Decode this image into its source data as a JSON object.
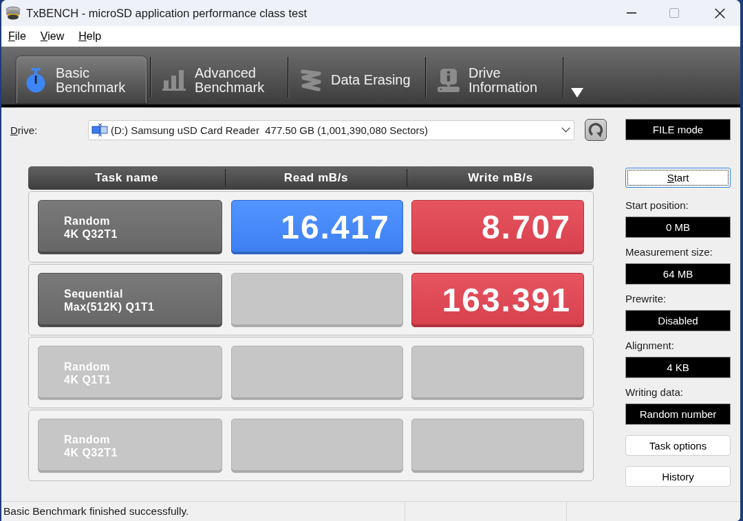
{
  "window": {
    "title": "TxBENCH - microSD application performance class test"
  },
  "menu": [
    "File",
    "View",
    "Help"
  ],
  "toolbar": {
    "tabs": [
      {
        "label": "Basic\nBenchmark",
        "selected": true
      },
      {
        "label": "Advanced\nBenchmark",
        "selected": false
      },
      {
        "label": "Data Erasing",
        "selected": false
      },
      {
        "label": "Drive\nInformation",
        "selected": false
      }
    ]
  },
  "drive": {
    "label": "Drive:",
    "value": "(D:) Samsung uSD Card Reader  477.50 GB (1,001,390,080 Sectors)",
    "mode": "FILE mode"
  },
  "table": {
    "columns": [
      "Task name",
      "Read mB/s",
      "Write mB/s"
    ],
    "rows": [
      {
        "task": "Random\n4K Q32T1",
        "completed": true,
        "read": "16.417",
        "write": "8.707"
      },
      {
        "task": "Sequential\nMax(512K) Q1T1",
        "completed": true,
        "write": "163.391"
      },
      {
        "task": "Random\n4K Q1T1",
        "completed": false
      },
      {
        "task": "Random\n4K Q32T1",
        "completed": false
      }
    ]
  },
  "settings": {
    "start_button": {
      "label": "Start",
      "focused": true
    },
    "fields": [
      {
        "label": "Start position:",
        "value": "0 MB"
      },
      {
        "label": "Measurement size:",
        "value": "64 MB"
      },
      {
        "label": "Prewrite:",
        "value": "Disabled"
      },
      {
        "label": "Alignment:",
        "value": "4 KB"
      },
      {
        "label": "Writing data:",
        "value": "Random number"
      }
    ],
    "buttons": [
      "Task options",
      "History"
    ]
  },
  "status_bar": {
    "message": "Basic Benchmark finished successfully."
  }
}
